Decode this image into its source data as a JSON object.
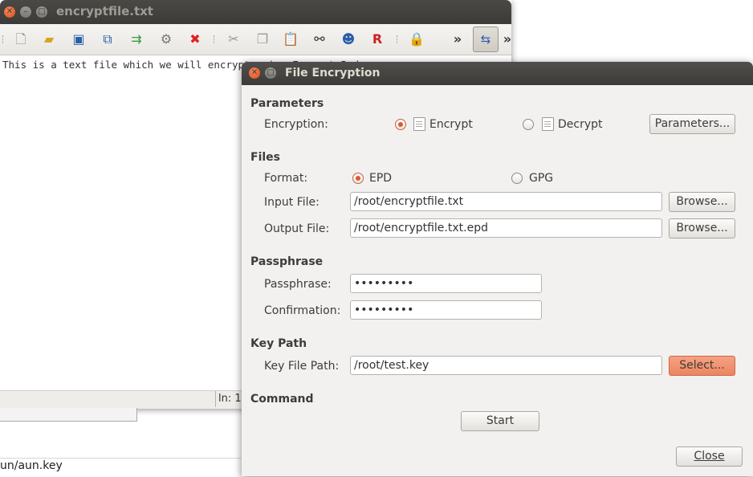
{
  "editor": {
    "title": "encryptfile.txt",
    "content": "This is a text file which we will encrypt using Encrypt Pad.",
    "status_line": "ln: 1",
    "toolbar_overflow": "»",
    "icons": [
      "new-file-icon",
      "open-folder-icon",
      "save-icon",
      "save-as-icon",
      "recent-icon",
      "print-preview-icon",
      "close-file-icon",
      "cut-icon",
      "copy-icon",
      "paste-icon",
      "find-icon",
      "user-icon",
      "replace-icon",
      "lock-icon"
    ]
  },
  "behind": {
    "path_text": "un/aun.key"
  },
  "dialog": {
    "title": "File Encryption",
    "parameters": {
      "heading": "Parameters",
      "encryption_label": "Encryption:",
      "encrypt_label": "Encrypt",
      "decrypt_label": "Decrypt",
      "selected": "Encrypt",
      "parameters_button": "Parameters..."
    },
    "files": {
      "heading": "Files",
      "format_label": "Format:",
      "format_epd": "EPD",
      "format_gpg": "GPG",
      "selected_format": "EPD",
      "input_label": "Input File:",
      "input_value": "/root/encryptfile.txt",
      "output_label": "Output File:",
      "output_value": "/root/encryptfile.txt.epd",
      "browse_label": "Browse..."
    },
    "passphrase": {
      "heading": "Passphrase",
      "passphrase_label": "Passphrase:",
      "passphrase_value": "•••••••••",
      "confirmation_label": "Confirmation:",
      "confirmation_value": "•••••••••"
    },
    "key_path": {
      "heading": "Key Path",
      "label": "Key File Path:",
      "value": "/root/test.key",
      "select_button": "Select..."
    },
    "command": {
      "heading": "Command",
      "start_button": "Start"
    },
    "close_button": "Close"
  },
  "colors": {
    "accent": "#ed8560",
    "titlebar": "#3c3b37",
    "dialog_bg": "#f2f1f0"
  }
}
